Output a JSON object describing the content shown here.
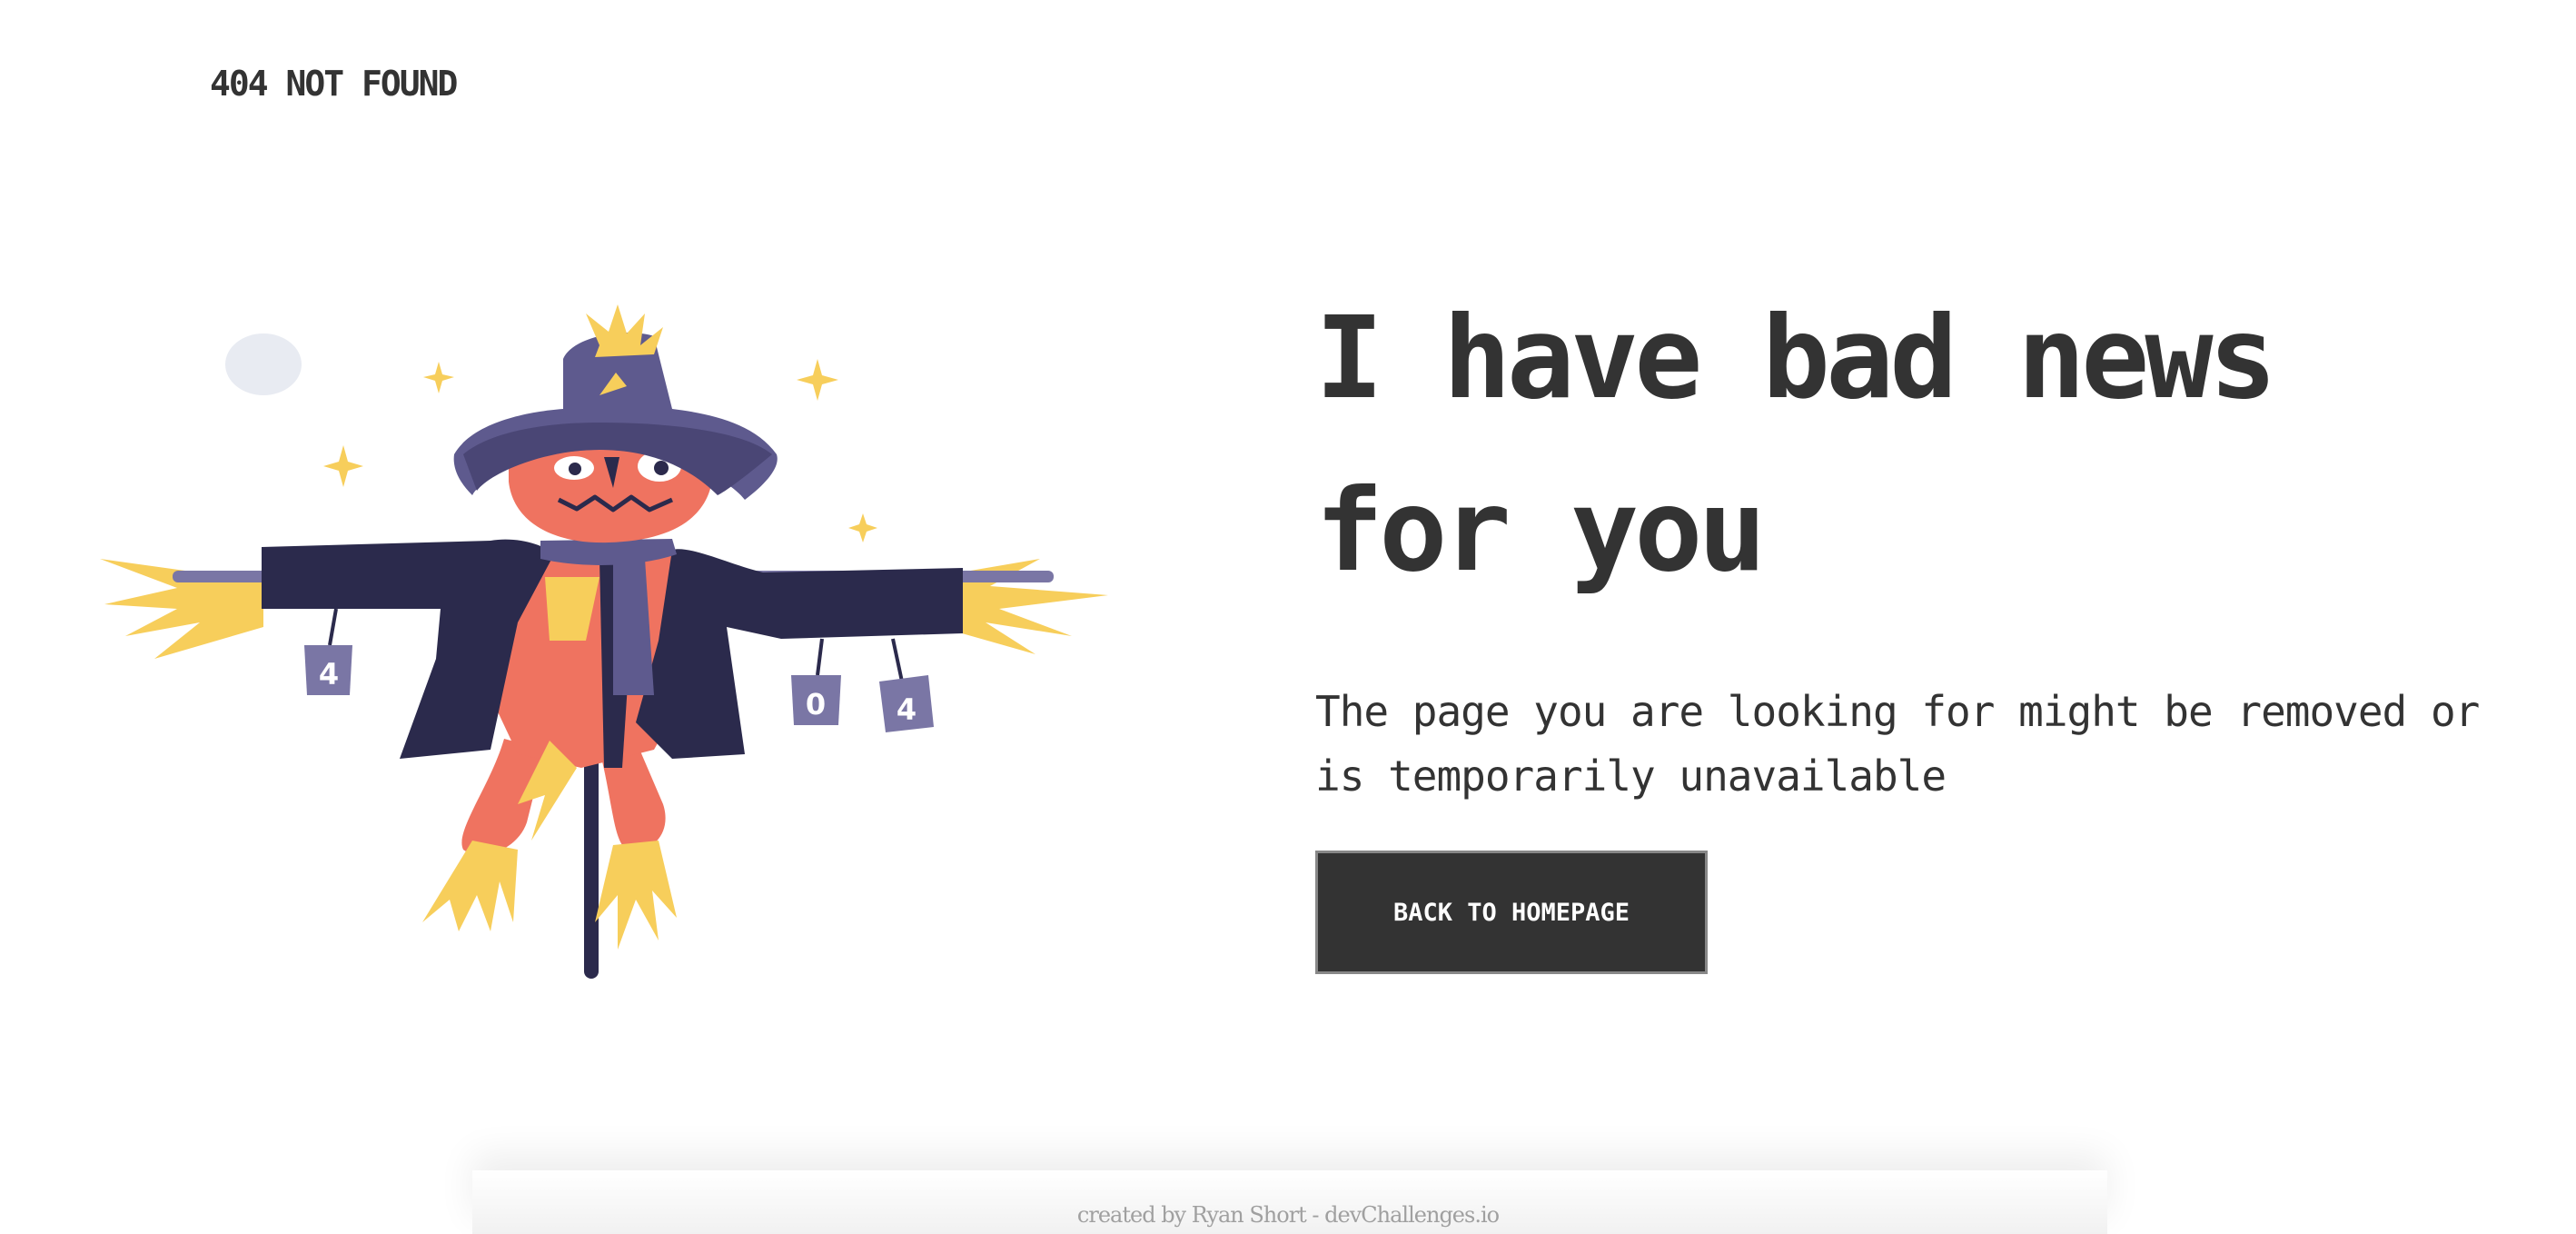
{
  "header": {
    "brand": "404 NOT FOUND"
  },
  "main": {
    "headline": "I have bad news for you",
    "description": "The page you are looking for might be removed or is temporarily unavailable",
    "back_button_label": "BACK TO HOMEPAGE"
  },
  "illustration": {
    "can_labels": [
      "4",
      "0",
      "4"
    ]
  },
  "footer": {
    "credit": "created by Ryan Short - devChallenges.io"
  },
  "colors": {
    "text": "#333333",
    "button_bg": "#333333",
    "button_text": "#ffffff",
    "coat": "#2b2a4c",
    "hat": "#5e5a8e",
    "head": "#ef7360",
    "straw": "#f7ce5b",
    "cans": "#7a76a5",
    "moon": "#e8ebf2",
    "footer_text": "#a0a0a0"
  }
}
